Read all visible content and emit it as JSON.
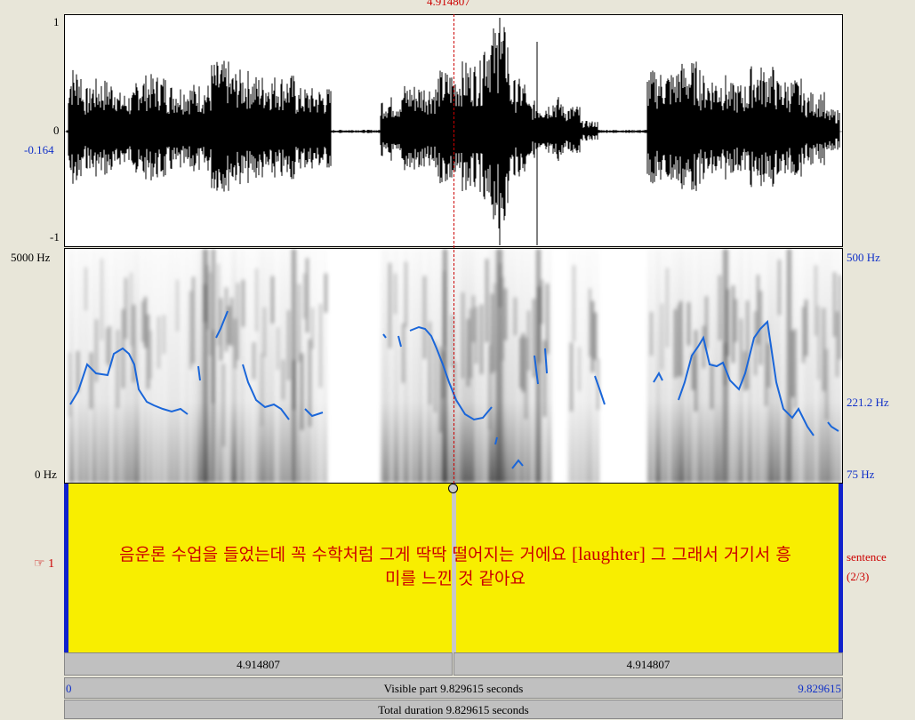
{
  "cursor": {
    "time": "4.914807"
  },
  "waveform": {
    "y_max": "1",
    "y_zero": "0",
    "y_cursor_value": "-0.164",
    "y_min": "-1"
  },
  "spectrogram": {
    "freq_top": "5000 Hz",
    "freq_bottom": "0 Hz",
    "pitch_top": "500 Hz",
    "pitch_cursor": "221.2 Hz",
    "pitch_bottom": "75 Hz"
  },
  "tier": {
    "number": "1",
    "name": "sentence",
    "count": "(2/3)",
    "text_part1": "음운론 수업을 들었는데 꼭 수학처럼 그게 딱딱 떨어지는 거에요 ",
    "text_bracket": "[laughter]",
    "text_part2": " 그 그래서 거기서 흥",
    "text_line2": "미를 느낀 것 같아요"
  },
  "selection": {
    "left_duration": "4.914807",
    "right_duration": "4.914807"
  },
  "visible": {
    "start": "0",
    "label": "Visible part 9.829615 seconds",
    "end": "9.829615"
  },
  "total": {
    "label": "Total duration 9.829615 seconds"
  },
  "colors": {
    "tier_background": "#f8ee00",
    "pitch_contour": "#1a66d9",
    "cursor": "#cc0000"
  }
}
